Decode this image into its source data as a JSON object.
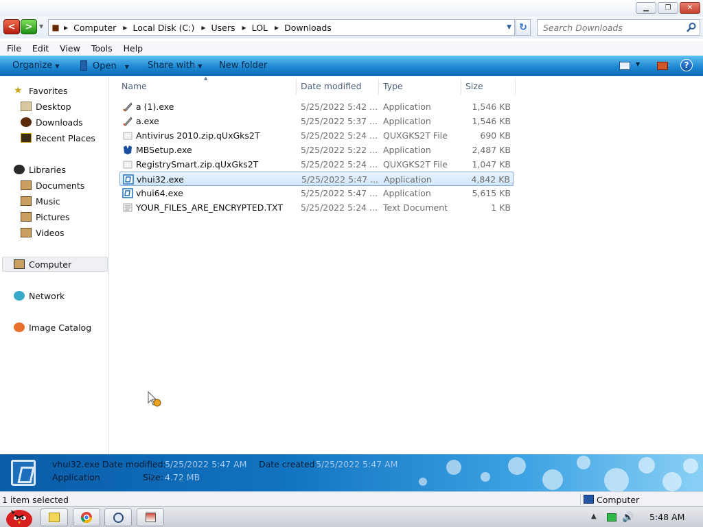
{
  "window": {
    "minimize_glyph": "▁",
    "maximize_glyph": "❐",
    "close_glyph": "✕"
  },
  "address": {
    "crumbs": [
      "Computer",
      "Local Disk (C:)",
      "Users",
      "LOL",
      "Downloads"
    ],
    "separator": "▶",
    "back_glyph": "<",
    "forward_glyph": ">",
    "refresh_glyph": "↻",
    "search_placeholder": "Search Downloads"
  },
  "menu": {
    "items": [
      "File",
      "Edit",
      "View",
      "Tools",
      "Help"
    ]
  },
  "commands": {
    "organize": "Organize",
    "open": "Open",
    "share_with": "Share with",
    "new_folder": "New folder",
    "help_glyph": "?"
  },
  "nav": {
    "favorites": "Favorites",
    "desktop": "Desktop",
    "downloads": "Downloads",
    "recent_places": "Recent Places",
    "libraries": "Libraries",
    "documents": "Documents",
    "music": "Music",
    "pictures": "Pictures",
    "videos": "Videos",
    "computer": "Computer",
    "network": "Network",
    "image_catalog": "Image Catalog"
  },
  "columns": {
    "name": "Name",
    "date_modified": "Date modified",
    "type": "Type",
    "size": "Size"
  },
  "files": [
    {
      "name": "a (1).exe",
      "date": "5/25/2022 5:42 ...",
      "type": "Application",
      "size": "1,546 KB",
      "icon": "rocket-icon"
    },
    {
      "name": "a.exe",
      "date": "5/25/2022 5:37 ...",
      "type": "Application",
      "size": "1,546 KB",
      "icon": "rocket-icon"
    },
    {
      "name": "Antivirus 2010.zip.qUxGks2T",
      "date": "5/25/2022 5:24 ...",
      "type": "QUXGKS2T File",
      "size": "690 KB",
      "icon": "blank-file-icon"
    },
    {
      "name": "MBSetup.exe",
      "date": "5/25/2022 5:22 ...",
      "type": "Application",
      "size": "2,487 KB",
      "icon": "malwarebytes-icon"
    },
    {
      "name": "RegistrySmart.zip.qUxGks2T",
      "date": "5/25/2022 5:24 ...",
      "type": "QUXGKS2T File",
      "size": "1,047 KB",
      "icon": "blank-file-icon"
    },
    {
      "name": "vhui32.exe",
      "date": "5/25/2022 5:47 ...",
      "type": "Application",
      "size": "4,842 KB",
      "icon": "app-window-icon",
      "selected": true
    },
    {
      "name": "vhui64.exe",
      "date": "5/25/2022 5:47 ...",
      "type": "Application",
      "size": "5,615 KB",
      "icon": "app-window-icon"
    },
    {
      "name": "YOUR_FILES_ARE_ENCRYPTED.TXT",
      "date": "5/25/2022 5:24 ...",
      "type": "Text Document",
      "size": "1 KB",
      "icon": "text-file-icon"
    }
  ],
  "details": {
    "file_name": "vhui32.exe",
    "file_type": "Application",
    "date_modified_label": "Date modified:",
    "date_modified": "5/25/2022 5:47 AM",
    "date_created_label": "Date created:",
    "date_created": "5/25/2022 5:47 AM",
    "size_label": "Size:",
    "size": "4.72 MB"
  },
  "status": {
    "selection": "1 item selected",
    "location": "Computer"
  },
  "taskbar": {
    "clock": "5:48 AM",
    "tray_arrow": "▲",
    "volume_glyph": "🔊"
  },
  "colors": {
    "accent": "#1984d0",
    "selection": "#cfe5fa",
    "close_red": "#c6412c"
  }
}
